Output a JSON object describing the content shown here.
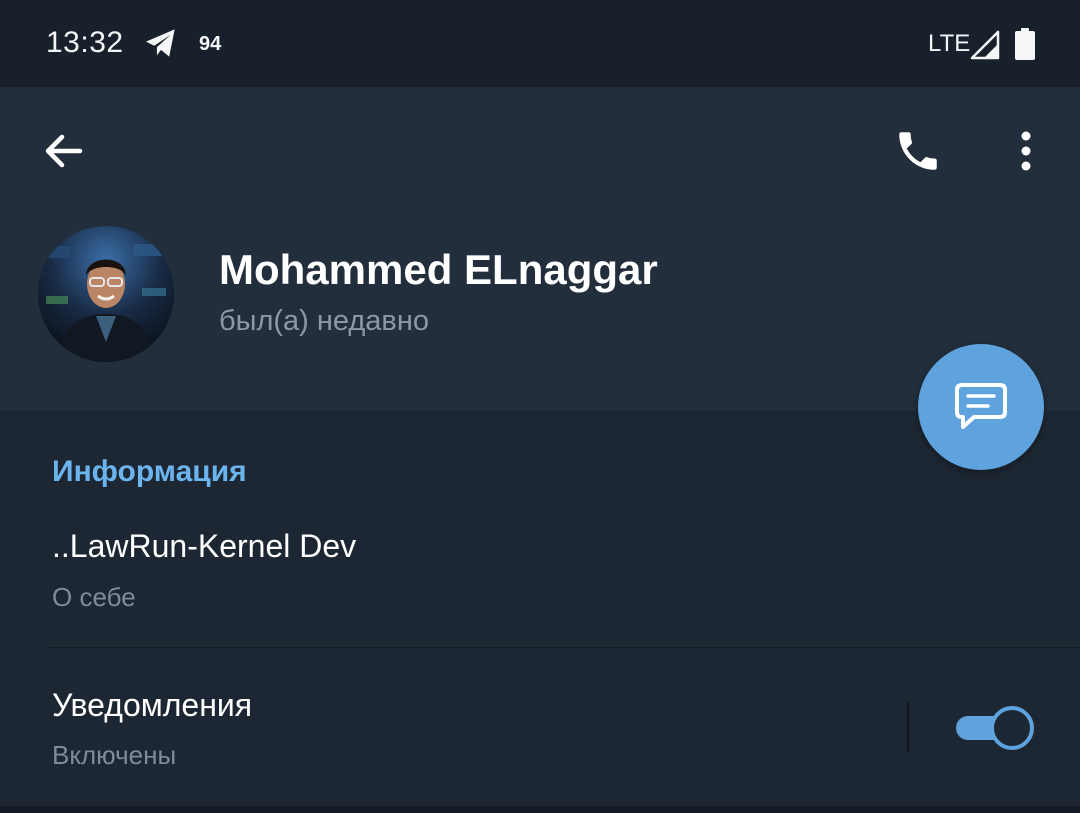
{
  "status_bar": {
    "time": "13:32",
    "notification_icon": "telegram-icon",
    "notification_count": "94",
    "network": "LTE",
    "signal_icon": "signal-icon",
    "battery_icon": "battery-icon"
  },
  "toolbar": {
    "back_icon": "arrow-left-icon",
    "call_icon": "phone-icon",
    "more_icon": "more-vertical-icon"
  },
  "profile": {
    "name": "Mohammed ELnaggar",
    "last_seen": "был(а) недавно",
    "avatar": "profile-photo"
  },
  "fab": {
    "icon": "message-icon"
  },
  "info": {
    "section_title": "Информация",
    "bio_value": "..LawRun-Kernel Dev",
    "bio_caption": "О себе"
  },
  "notifications": {
    "title": "Уведомления",
    "status": "Включены",
    "enabled": true
  },
  "colors": {
    "background": "#1d2733",
    "header": "#222e3c",
    "status_bar": "#18212b",
    "accent": "#5ea3de",
    "section_title": "#6cb4ee",
    "secondary_text": "#8b99a6"
  }
}
